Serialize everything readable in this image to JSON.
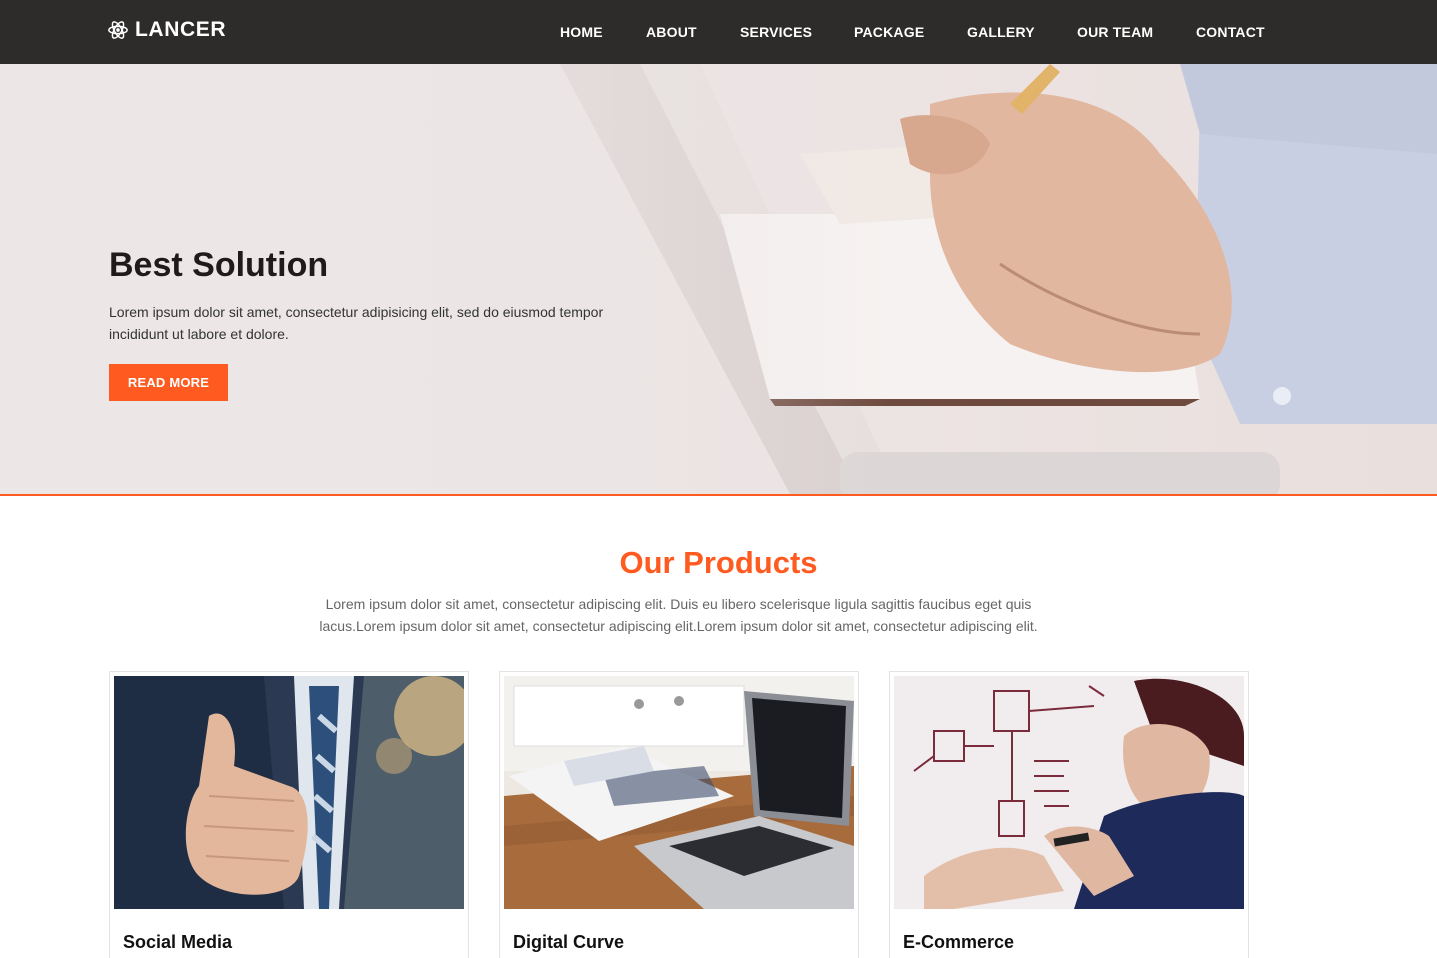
{
  "brand": {
    "name": "LANCER",
    "icon": "atom-icon"
  },
  "nav": {
    "items": [
      {
        "label": "HOME"
      },
      {
        "label": "ABOUT"
      },
      {
        "label": "SERVICES"
      },
      {
        "label": "PACKAGE"
      },
      {
        "label": "GALLERY"
      },
      {
        "label": "OUR TEAM"
      },
      {
        "label": "CONTACT"
      }
    ]
  },
  "hero": {
    "title": "Best Solution",
    "text": "Lorem ipsum dolor sit amet, consectetur adipisicing elit, sed do eiusmod tempor incididunt ut labore et dolore.",
    "button": "READ MORE"
  },
  "products": {
    "title": "Our Products",
    "description": "Lorem ipsum dolor sit amet, consectetur adipiscing elit. Duis eu libero scelerisque ligula sagittis faucibus eget quis lacus.Lorem ipsum dolor sit amet, consectetur adipiscing elit.Lorem ipsum dolor sit amet, consectetur adipiscing elit.",
    "cards": [
      {
        "title": "Social Media"
      },
      {
        "title": "Digital Curve"
      },
      {
        "title": "E-Commerce"
      }
    ]
  },
  "colors": {
    "accent": "#ff5a1f",
    "navbar": "#2d2c2b"
  }
}
